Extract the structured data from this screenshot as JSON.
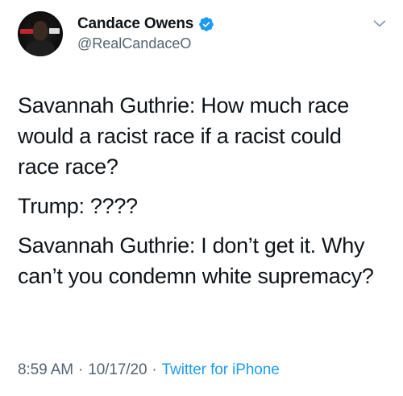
{
  "user": {
    "display_name": "Candace Owens",
    "handle": "@RealCandaceO",
    "verified": true,
    "avatar_icon": "profile-photo",
    "verified_icon": "verified-badge-icon",
    "verified_color": "#1d9bf0"
  },
  "tweet": {
    "paragraphs": [
      "Savannah Guthrie: How much race would a racist race if a racist could race race?",
      "Trump: ????",
      "Savannah Guthrie: I don’t get it. Why can’t you condemn white supremacy?"
    ],
    "time": "8:59 AM",
    "date": "10/17/20",
    "separator": "·",
    "source": "Twitter for iPhone"
  },
  "menu": {
    "icon": "chevron-down-icon"
  },
  "colors": {
    "text": "#0f1419",
    "secondary": "#536471",
    "accent": "#1d9bf0"
  }
}
